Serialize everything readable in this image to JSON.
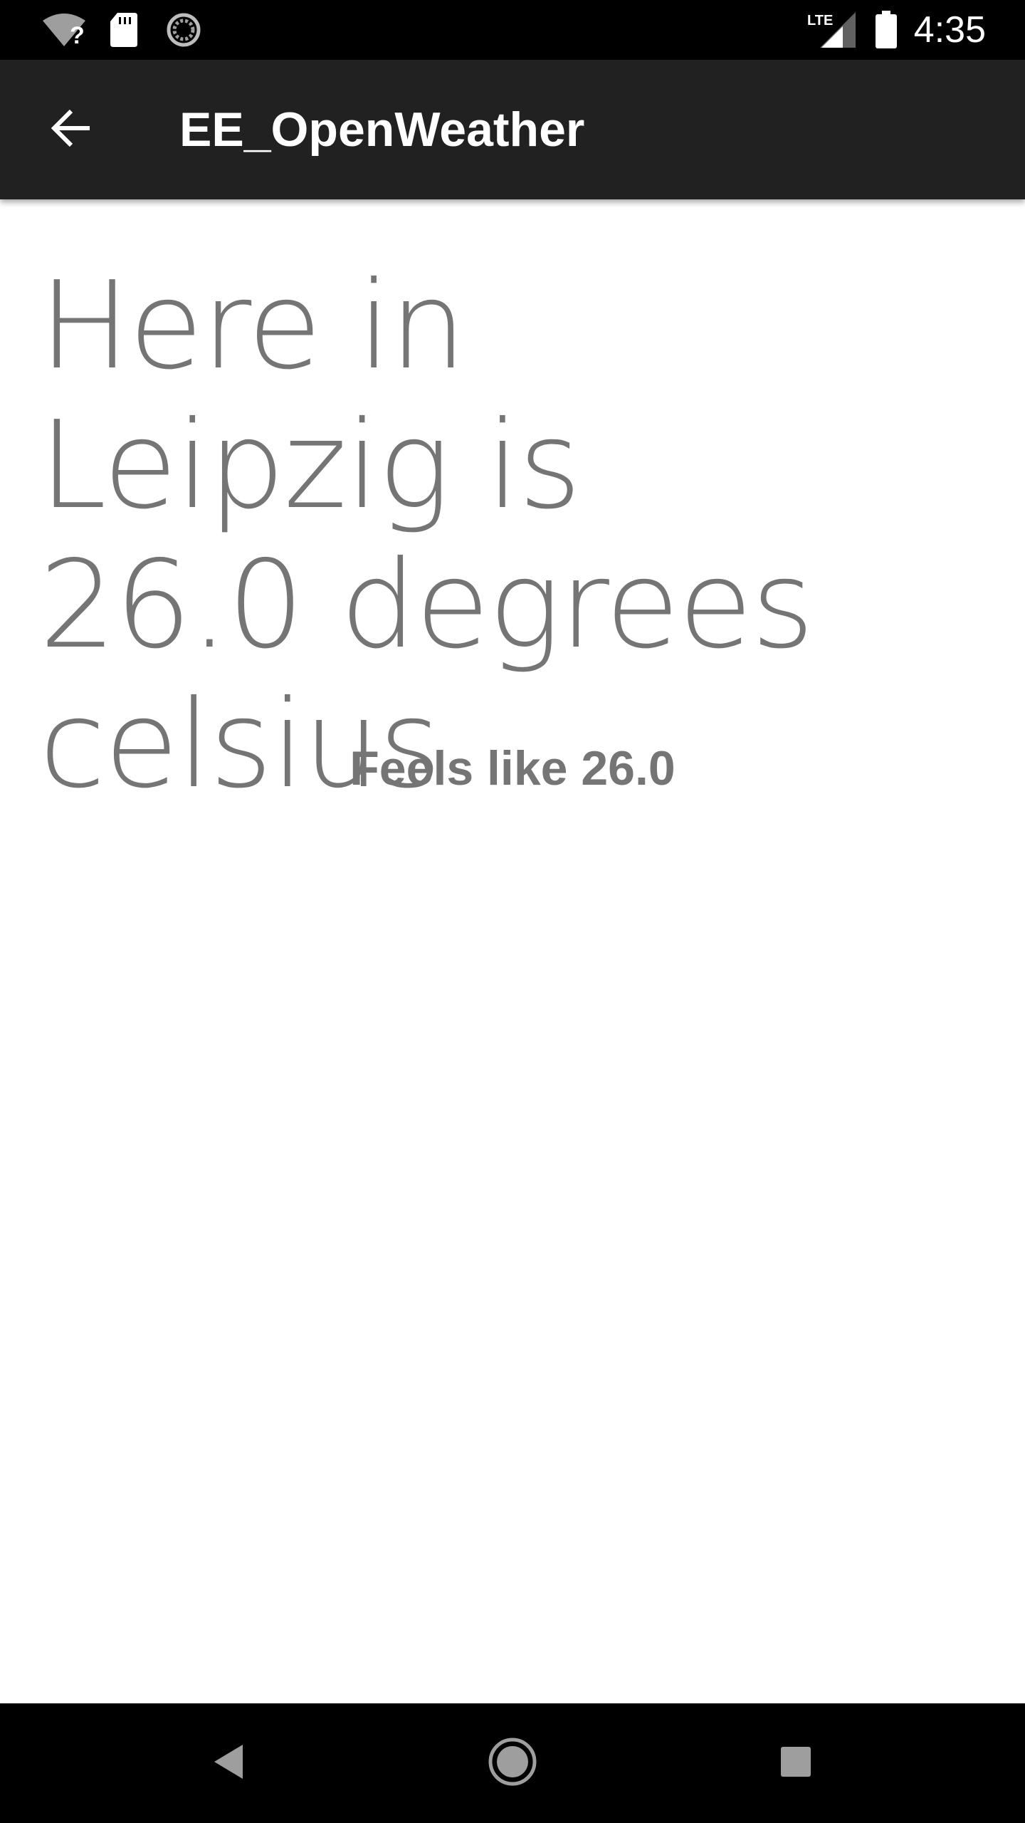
{
  "status_bar": {
    "time": "4:35",
    "network_label": "LTE",
    "icons": [
      "wifi-unknown-icon",
      "sd-card-icon",
      "sync-icon",
      "lte-signal-icon",
      "battery-icon"
    ]
  },
  "app_bar": {
    "title": "EE_OpenWeather",
    "back_icon": "arrow-back-icon"
  },
  "main": {
    "headline": "Here in Leipzig is 26.0 degrees celsius",
    "feels_like": "Feels like 26.0"
  },
  "nav_bar": {
    "icons": [
      "back-triangle-icon",
      "home-circle-icon",
      "recents-square-icon"
    ]
  },
  "colors": {
    "status_bar": "#000000",
    "app_bar": "#212121",
    "text_primary": "#757575",
    "background": "#ffffff"
  }
}
